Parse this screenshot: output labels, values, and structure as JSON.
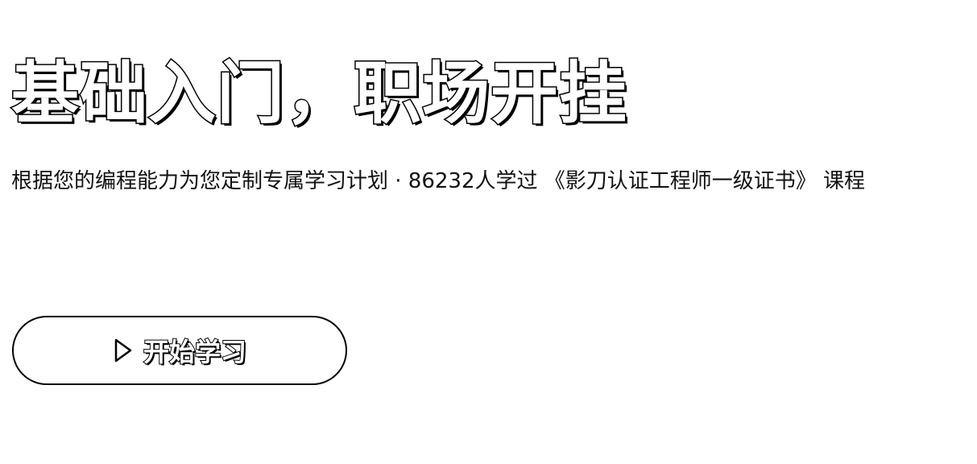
{
  "hero": {
    "title": "基础入门，职场开挂",
    "description": "根据您的编程能力为您定制专属学习计划 · 86232人学过 《影刀认证工程师一级证书》 课程"
  },
  "actions": {
    "start_label": "开始学习",
    "start_icon": "play-icon"
  }
}
